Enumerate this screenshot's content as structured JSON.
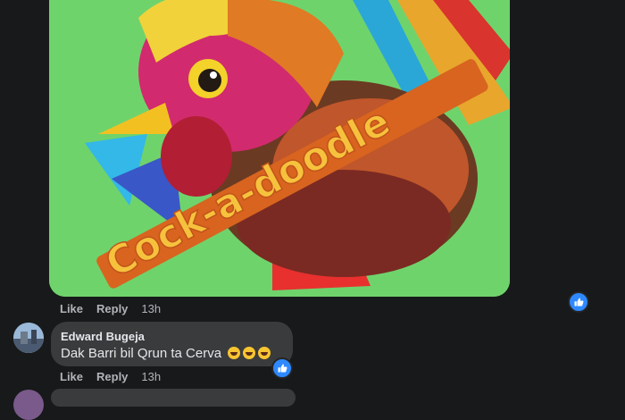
{
  "post_image": {
    "caption_art": "Cock-a-doodle"
  },
  "first_comment": {
    "actions": {
      "like": "Like",
      "reply": "Reply",
      "time": "13h"
    }
  },
  "comment": {
    "author": "Edward Bugeja",
    "text": "Dak Barri bil Qrun ta Cerva",
    "emoji_count": 3,
    "actions": {
      "like": "Like",
      "reply": "Reply",
      "time": "13h"
    }
  },
  "colors": {
    "background": "#18191a",
    "bubble": "#3a3b3c",
    "like_blue": "#2e89ff",
    "image_green": "#6fd36c"
  },
  "icons": [
    "like-reaction-icon",
    "laughing-emoji-icon"
  ]
}
